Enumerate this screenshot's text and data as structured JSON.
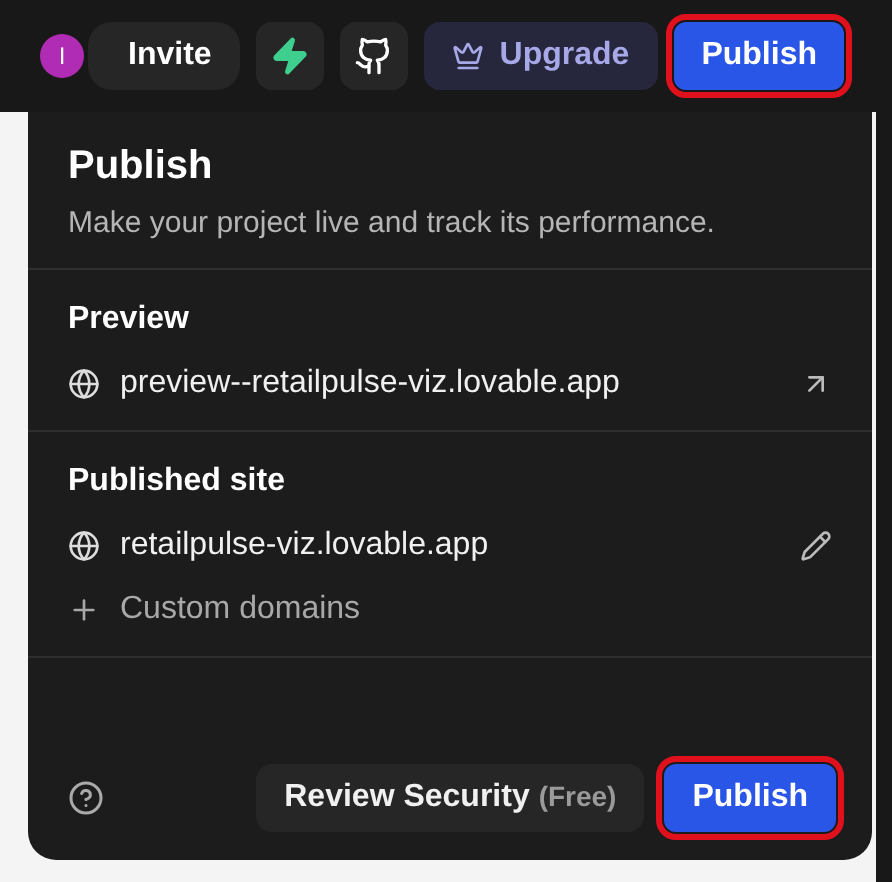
{
  "topbar": {
    "avatar": "I",
    "invite": "Invite",
    "upgrade": "Upgrade",
    "publish": {
      "label": "Publish",
      "highlighted": true
    }
  },
  "panel": {
    "title": "Publish",
    "subtitle": "Make your project live and track its performance.",
    "preview": {
      "heading": "Preview",
      "url": "preview--retailpulse-viz.lovable.app"
    },
    "published": {
      "heading": "Published site",
      "url": "retailpulse-viz.lovable.app",
      "custom": "Custom domains"
    },
    "footer": {
      "review": "Review Security",
      "review_note": "(Free)",
      "publish": {
        "label": "Publish",
        "highlighted": true
      }
    }
  }
}
